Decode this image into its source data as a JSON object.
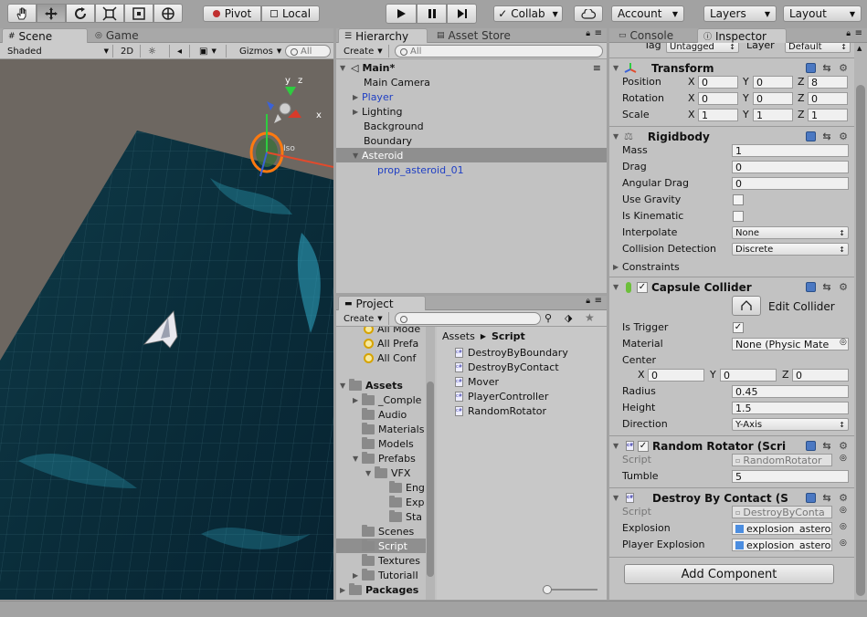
{
  "toolbar": {
    "tools": [
      "hand-tool",
      "move-tool",
      "rotate-tool",
      "scale-tool",
      "rect-tool",
      "transform-tool"
    ],
    "pivot": "Pivot",
    "local": "Local",
    "collab": "Collab",
    "account": "Account",
    "layers": "Layers",
    "layout": "Layout"
  },
  "scene": {
    "tab_scene": "Scene",
    "tab_game": "Game",
    "shade": "Shaded",
    "mode2d": "2D",
    "gizmos": "Gizmos",
    "search": "All",
    "gizmo_x": "x",
    "gizmo_y": "y",
    "gizmo_z": "z",
    "iso": "Iso"
  },
  "hierarchy": {
    "tab": "Hierarchy",
    "tab2": "Asset Store",
    "create": "Create",
    "search": "All",
    "scene_name": "Main*",
    "items": [
      {
        "label": "Main Camera",
        "color": "#111"
      },
      {
        "label": "Player",
        "color": "#1f3fc4"
      },
      {
        "label": "Lighting",
        "color": "#111"
      },
      {
        "label": "Background",
        "color": "#111"
      },
      {
        "label": "Boundary",
        "color": "#111"
      },
      {
        "label": "Asteroid",
        "color": "#111"
      },
      {
        "label": "prop_asteroid_01",
        "color": "#1f3fc4"
      }
    ]
  },
  "project": {
    "tab": "Project",
    "create": "Create",
    "tree": [
      {
        "label": "All Mode"
      },
      {
        "label": "All Prefa"
      },
      {
        "label": "All Conf"
      },
      {
        "label": "Assets"
      },
      {
        "label": "_Comple"
      },
      {
        "label": "Audio"
      },
      {
        "label": "Materials"
      },
      {
        "label": "Models"
      },
      {
        "label": "Prefabs"
      },
      {
        "label": "VFX"
      },
      {
        "label": "Eng"
      },
      {
        "label": "Exp"
      },
      {
        "label": "Sta"
      },
      {
        "label": "Scenes"
      },
      {
        "label": "Script"
      },
      {
        "label": "Textures"
      },
      {
        "label": "TutorialI"
      },
      {
        "label": "Packages"
      }
    ],
    "breadcrumb_root": "Assets",
    "breadcrumb_current": "Script",
    "files": [
      "DestroyByBoundary",
      "DestroyByContact",
      "Mover",
      "PlayerController",
      "RandomRotator"
    ]
  },
  "inspector": {
    "tab_console": "Console",
    "tab_inspector": "Inspector",
    "tag_label": "Tag",
    "tag_value": "Untagged",
    "layer_label": "Layer",
    "layer_value": "Default",
    "transform": {
      "title": "Transform",
      "position": {
        "label": "Position",
        "x": "0",
        "y": "0",
        "z": "8"
      },
      "rotation": {
        "label": "Rotation",
        "x": "0",
        "y": "0",
        "z": "0"
      },
      "scale": {
        "label": "Scale",
        "x": "1",
        "y": "1",
        "z": "1"
      }
    },
    "rigidbody": {
      "title": "Rigidbody",
      "mass": {
        "label": "Mass",
        "value": "1"
      },
      "drag": {
        "label": "Drag",
        "value": "0"
      },
      "angular": {
        "label": "Angular Drag",
        "value": "0"
      },
      "gravity": {
        "label": "Use Gravity"
      },
      "kinematic": {
        "label": "Is Kinematic"
      },
      "interpolate": {
        "label": "Interpolate",
        "value": "None"
      },
      "collision": {
        "label": "Collision Detection",
        "value": "Discrete"
      },
      "constraints": {
        "label": "Constraints"
      }
    },
    "capsule": {
      "title": "Capsule Collider",
      "edit": "Edit Collider",
      "trigger": {
        "label": "Is Trigger"
      },
      "material": {
        "label": "Material",
        "value": "None (Physic Mate"
      },
      "center": {
        "label": "Center",
        "x": "0",
        "y": "0",
        "z": "0"
      },
      "radius": {
        "label": "Radius",
        "value": "0.45"
      },
      "height": {
        "label": "Height",
        "value": "1.5"
      },
      "direction": {
        "label": "Direction",
        "value": "Y-Axis"
      }
    },
    "rotator": {
      "title": "Random Rotator (Scri",
      "script": {
        "label": "Script",
        "value": "RandomRotator"
      },
      "tumble": {
        "label": "Tumble",
        "value": "5"
      }
    },
    "contact": {
      "title": "Destroy By Contact (S",
      "script": {
        "label": "Script",
        "value": "DestroyByConta"
      },
      "explosion": {
        "label": "Explosion",
        "value": "explosion_astero"
      },
      "player_explosion": {
        "label": "Player Explosion",
        "value": "explosion_astero"
      }
    },
    "add_component": "Add Component"
  },
  "colors": {
    "toolbar_bg": "#a2a2a2",
    "panel_bg": "#c2c2c2",
    "selection": "#8f8f8f",
    "water": "#0c3d4c",
    "blue_text": "#1f3fc4"
  }
}
